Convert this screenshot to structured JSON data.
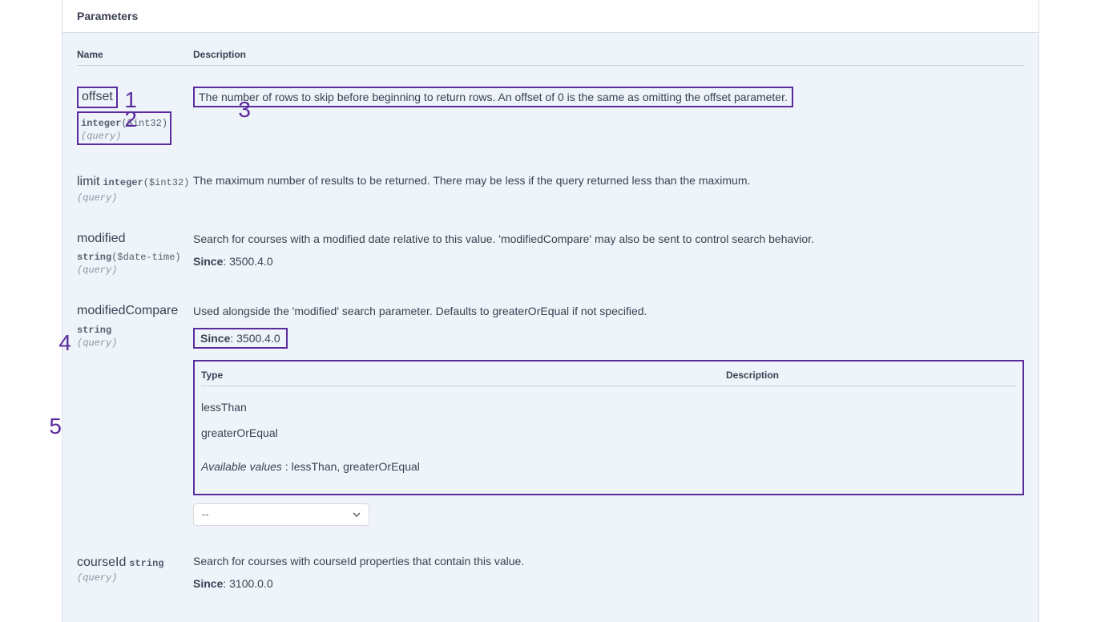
{
  "section_title": "Parameters",
  "columns": {
    "name": "Name",
    "description": "Description"
  },
  "enum_columns": {
    "type": "Type",
    "description": "Description"
  },
  "since_label": "Since",
  "available_values_label": "Available values",
  "select_placeholder": "--",
  "parameters": [
    {
      "name": "offset",
      "type": "integer",
      "format": "($int32)",
      "in": "(query)",
      "description": "The number of rows to skip before beginning to return rows. An offset of 0 is the same as omitting the offset parameter."
    },
    {
      "name": "limit",
      "type": "integer",
      "format": "($int32)",
      "in": "(query)",
      "description": "The maximum number of results to be returned. There may be less if the query returned less than the maximum."
    },
    {
      "name": "modified",
      "type": "string",
      "format": "($date-time)",
      "in": "(query)",
      "description": "Search for courses with a modified date relative to this value. 'modifiedCompare' may also be sent to control search behavior.",
      "since": "3500.4.0"
    },
    {
      "name": "modifiedCompare",
      "type": "string",
      "format": "",
      "in": "(query)",
      "description": "Used alongside the 'modified' search parameter. Defaults to greaterOrEqual if not specified.",
      "since": "3500.4.0",
      "enum": [
        "lessThan",
        "greaterOrEqual"
      ],
      "available_values_text": "lessThan, greaterOrEqual"
    },
    {
      "name": "courseId",
      "type": "string",
      "format": "",
      "in": "(query)",
      "description": "Search for courses with courseId properties that contain this value.",
      "since": "3100.0.0"
    }
  ],
  "annotations": {
    "1": "offset parameter name",
    "2": "offset type and location",
    "3": "offset description text",
    "4": "Since version line",
    "5": "enum type table and available values"
  }
}
